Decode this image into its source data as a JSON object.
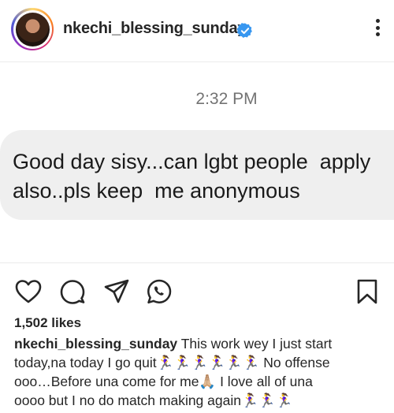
{
  "header": {
    "username": "nkechi_blessing_sunday"
  },
  "message": {
    "time": "2:32 PM",
    "line1": "Good day sisy...can lgbt people  apply",
    "line2": "also..pls keep  me anonymous"
  },
  "actions": {
    "icons": [
      "heart-icon",
      "comment-icon",
      "share-icon",
      "whatsapp-icon",
      "bookmark-icon"
    ]
  },
  "post": {
    "likes": "1,502 likes",
    "caption_username": "nkechi_blessing_sunday",
    "caption_line1": " This work wey I just start",
    "caption_line2": "today,na today I go quit🏃‍♀️🏃‍♀️🏃‍♀️🏃‍♀️🏃‍♀️🏃‍♀️  No offense",
    "caption_line3": "ooo…Before una come for me🙏🏼 I love all of una",
    "caption_line4": "oooo but I no do match making again🏃‍♀️🏃‍♀️🏃‍♀️"
  },
  "colors": {
    "verified": "#3897f0",
    "bubble": "#efefef",
    "timestamp": "#737373"
  }
}
